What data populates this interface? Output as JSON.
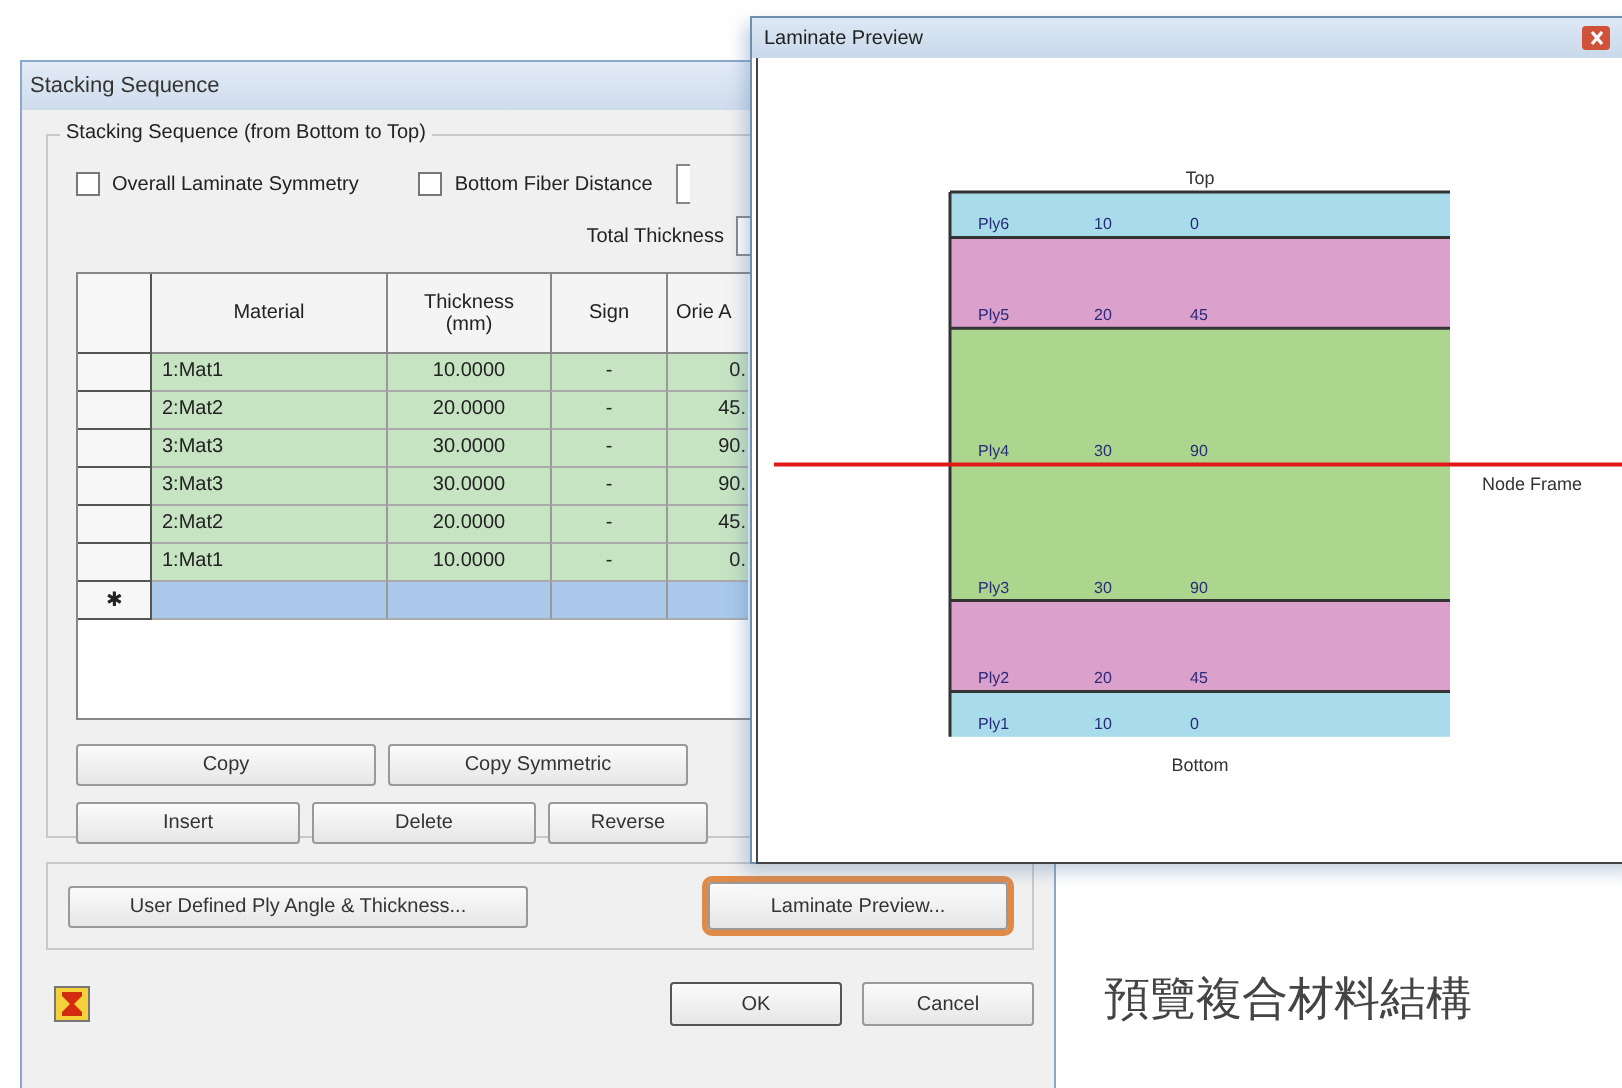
{
  "stacking_dialog": {
    "title": "Stacking Sequence",
    "group_title": "Stacking Sequence (from Bottom to Top)",
    "options": [
      {
        "kind": "checkbox",
        "label": "Overall Laminate Symmetry",
        "checked": false
      },
      {
        "kind": "checkbox-field",
        "label": "Bottom Fiber Distance",
        "checked": false
      }
    ],
    "total_thickness_label": "Total Thickness",
    "table": {
      "columns": [
        "Material",
        "Thickness (mm)",
        "Sign",
        "Orie A"
      ],
      "rows": [
        {
          "material": "1:Mat1",
          "thickness": "10.0000",
          "sign": "-",
          "column_4": "0."
        },
        {
          "material": "2:Mat2",
          "thickness": "20.0000",
          "sign": "-",
          "column_4": "45."
        },
        {
          "material": "3:Mat3",
          "thickness": "30.0000",
          "sign": "-",
          "column_4": "90."
        },
        {
          "material": "3:Mat3",
          "thickness": "30.0000",
          "sign": "-",
          "column_4": "90."
        },
        {
          "material": "2:Mat2",
          "thickness": "20.0000",
          "sign": "-",
          "column_4": "45."
        },
        {
          "material": "1:Mat1",
          "thickness": "10.0000",
          "sign": "-",
          "column_4": "0."
        }
      ],
      "new_row_marker": "✱"
    },
    "edit_buttons": [
      [
        "Copy",
        "Copy Symmetric"
      ],
      [
        "Insert",
        "Delete",
        "Reverse"
      ]
    ],
    "user_defined_button": "User Defined Ply Angle & Thickness...",
    "preview_button": {
      "label": "Laminate Preview...",
      "highlighted": true
    },
    "buttons": [
      "OK",
      "Cancel"
    ]
  },
  "preview_window": {
    "title": "Laminate Preview",
    "top_label": "Top",
    "bottom_label": "Bottom",
    "reference_label": "Node Frame",
    "plies": [
      {
        "name": "Ply6",
        "thickness": "10",
        "angle": "0",
        "color": "#a8dcea"
      },
      {
        "name": "Ply5",
        "thickness": "20",
        "angle": "45",
        "color": "#dba0cb"
      },
      {
        "name": "Ply4",
        "thickness": "30",
        "angle": "90",
        "color": "#acd68e"
      },
      {
        "name": "Ply3",
        "thickness": "30",
        "angle": "90",
        "color": "#acd68e"
      },
      {
        "name": "Ply2",
        "thickness": "20",
        "angle": "45",
        "color": "#dba0cb"
      },
      {
        "name": "Ply1",
        "thickness": "10",
        "angle": "0",
        "color": "#a8dcea"
      }
    ]
  },
  "caption": "預覽複合材料結構"
}
